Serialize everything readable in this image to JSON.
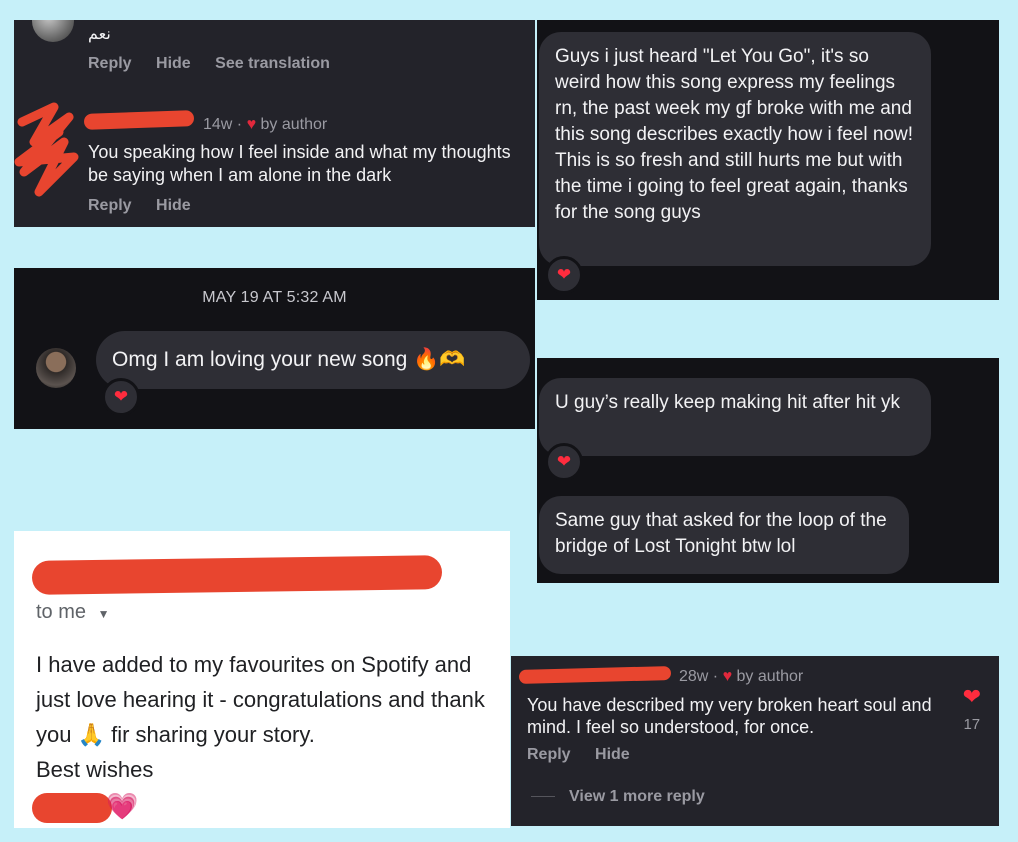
{
  "panel1": {
    "arabic_text": "نعم",
    "reply": "Reply",
    "hide": "Hide",
    "see_translation": "See translation",
    "comment_meta_time": "14w ·",
    "by_author": "by author",
    "comment_text": "You speaking how I feel inside and what my thoughts be saying when I am alone in the dark"
  },
  "panel2": {
    "message": "Guys i just heard \"Let You Go\", it's so weird how this song express my feelings rn, the past week my gf broke with me and this song describes exactly how i feel now!",
    "message2": "This is so fresh and still hurts me but with the time i going to feel great again, thanks for the song guys",
    "reaction": "❤"
  },
  "panel3": {
    "date": "MAY 19 AT 5:32 AM",
    "message": "Omg I am loving your new song 🔥🫶",
    "reaction": "❤"
  },
  "panel4": {
    "message1": "U guy’s really keep making hit after hit yk",
    "message2": "Same guy that asked for the loop of the bridge of Lost Tonight btw lol",
    "reaction": "❤"
  },
  "email": {
    "to_me": "to me",
    "body": "I have added to my favourites on Spotify and just love hearing it - congratulations and thank you 🙏 fir sharing your story.",
    "sign_off": "Best wishes",
    "emoji": "💗"
  },
  "panel6": {
    "meta_time": "28w ·",
    "by_author": "by author",
    "comment_text": "You have described my very broken heart soul and mind. I feel so understood, for once.",
    "reply": "Reply",
    "hide": "Hide",
    "like_count": "17",
    "view_more": "View 1 more reply"
  },
  "colors": {
    "background": "#c6f0f9",
    "redaction": "#e8452f",
    "heart": "#ff2c3e"
  }
}
